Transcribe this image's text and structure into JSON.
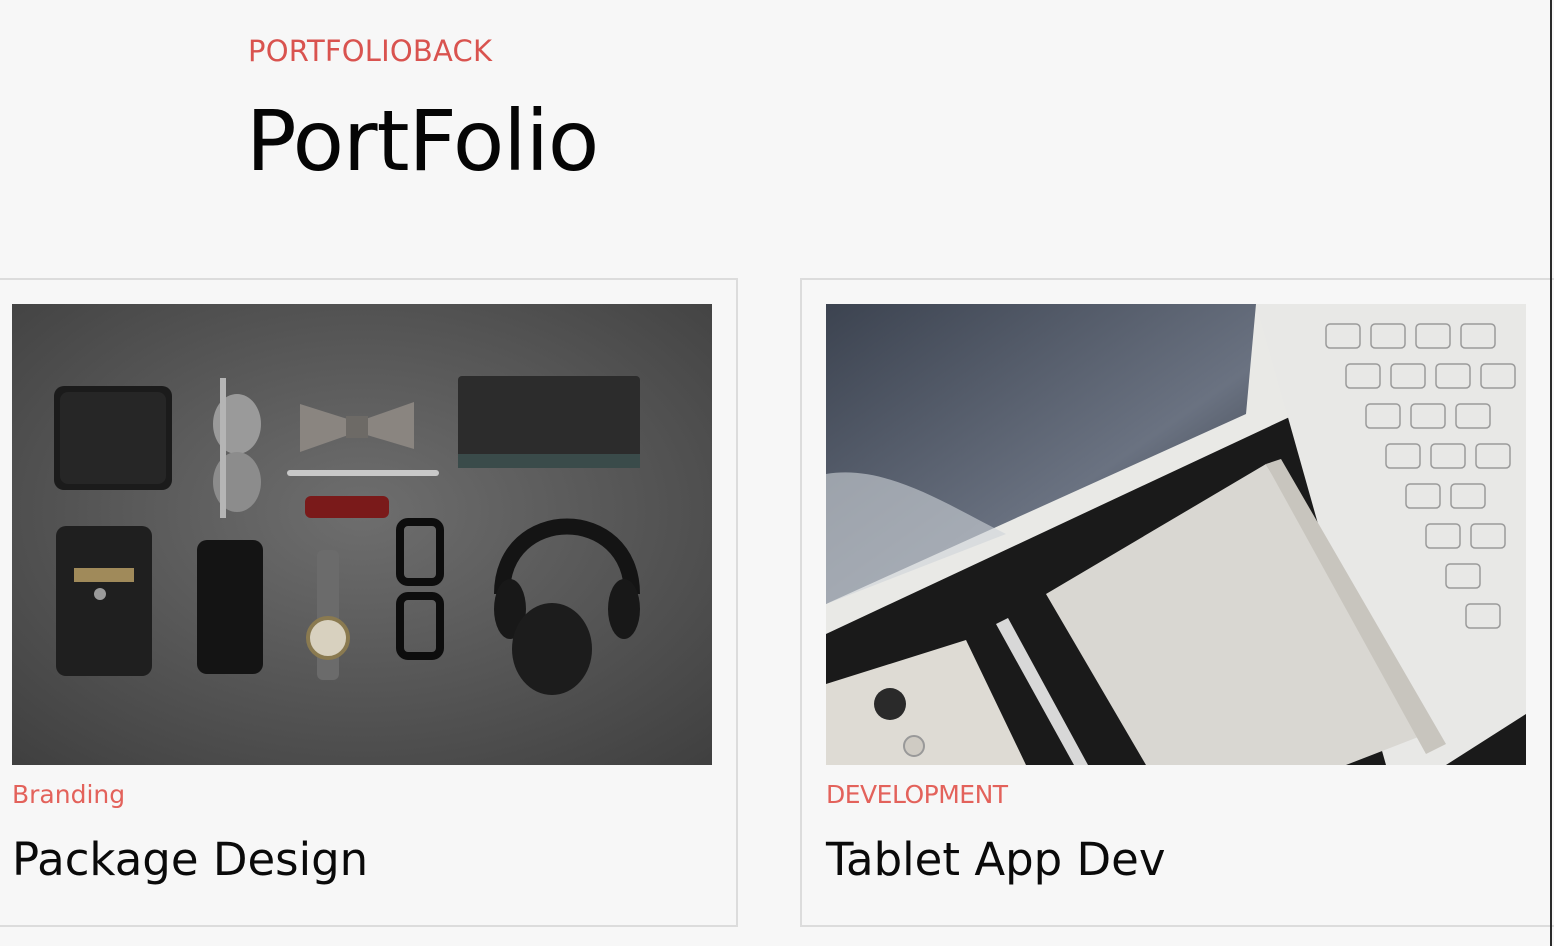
{
  "header": {
    "eyebrow": "PORTFOLIOBACK",
    "title": "PortFolio"
  },
  "cards": [
    {
      "category": "Branding",
      "title": "Package Design",
      "image": "flatlay-accessories-photo"
    },
    {
      "category": "DEVELOPMENT",
      "title": "Tablet App Dev",
      "image": "tablet-keyboard-notebook-photo"
    }
  ],
  "colors": {
    "accent": "#e3625b",
    "background": "#f7f7f7",
    "text": "#0a0a0a",
    "border": "#dcdcdc"
  }
}
